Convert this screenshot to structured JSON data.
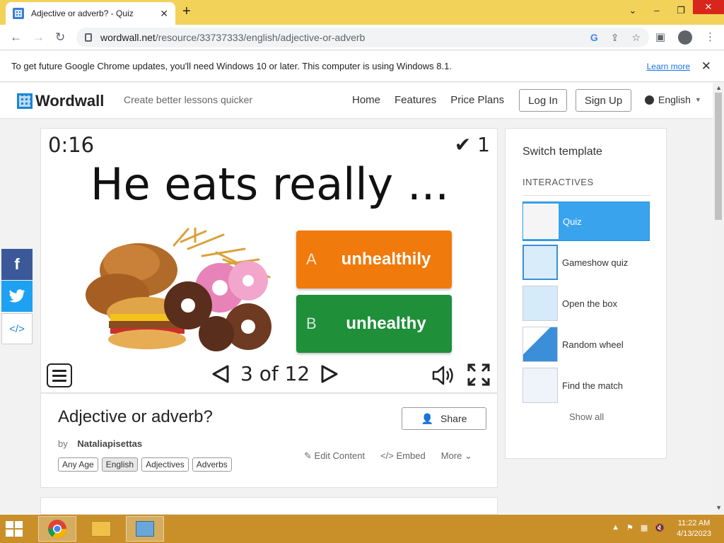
{
  "browser": {
    "tab_title": "Adjective or adverb? - Quiz",
    "tab_close": "✕",
    "new_tab": "+",
    "url_domain": "wordwall.net",
    "url_path": "/resource/33737333/english/adjective-or-adverb",
    "infobar_text": "To get future Google Chrome updates, you'll need Windows 10 or later. This computer is using Windows 8.1.",
    "infobar_link": "Learn more",
    "infobar_close": "✕"
  },
  "header": {
    "logo": "Wordwall",
    "tagline": "Create better lessons quicker",
    "nav": [
      "Home",
      "Features",
      "Price Plans"
    ],
    "login": "Log In",
    "signup": "Sign Up",
    "language": "English"
  },
  "social": {
    "facebook": "f",
    "twitter": "t",
    "embed": "</>"
  },
  "game": {
    "timer": "0:16",
    "score": "1",
    "question": "He eats really ...",
    "answers": [
      {
        "letter": "A",
        "text": "unhealthily",
        "color": "#f07a0c"
      },
      {
        "letter": "B",
        "text": "unhealthy",
        "color": "#1f8f3a"
      }
    ],
    "pager": "3 of 12"
  },
  "activity": {
    "title": "Adjective or adverb?",
    "by_label": "by",
    "author": "Nataliapisettas",
    "tags": [
      "Any Age",
      "English",
      "Adjectives",
      "Adverbs"
    ],
    "share": "Share",
    "edit": "Edit Content",
    "embed": "Embed",
    "more": "More"
  },
  "templates": {
    "heading": "Switch template",
    "category": "INTERACTIVES",
    "items": [
      {
        "label": "Quiz",
        "active": true
      },
      {
        "label": "Gameshow quiz",
        "active": false
      },
      {
        "label": "Open the box",
        "active": false
      },
      {
        "label": "Random wheel",
        "active": false
      },
      {
        "label": "Find the match",
        "active": false
      }
    ],
    "show_all": "Show all"
  },
  "taskbar": {
    "time": "11:22 AM",
    "date": "4/13/2023"
  },
  "colors": {
    "titlebar": "#f3d25a",
    "facebook": "#3b5998",
    "twitter": "#1da1f2",
    "active_template": "#3aa3ee",
    "taskbar": "#c9902a"
  }
}
